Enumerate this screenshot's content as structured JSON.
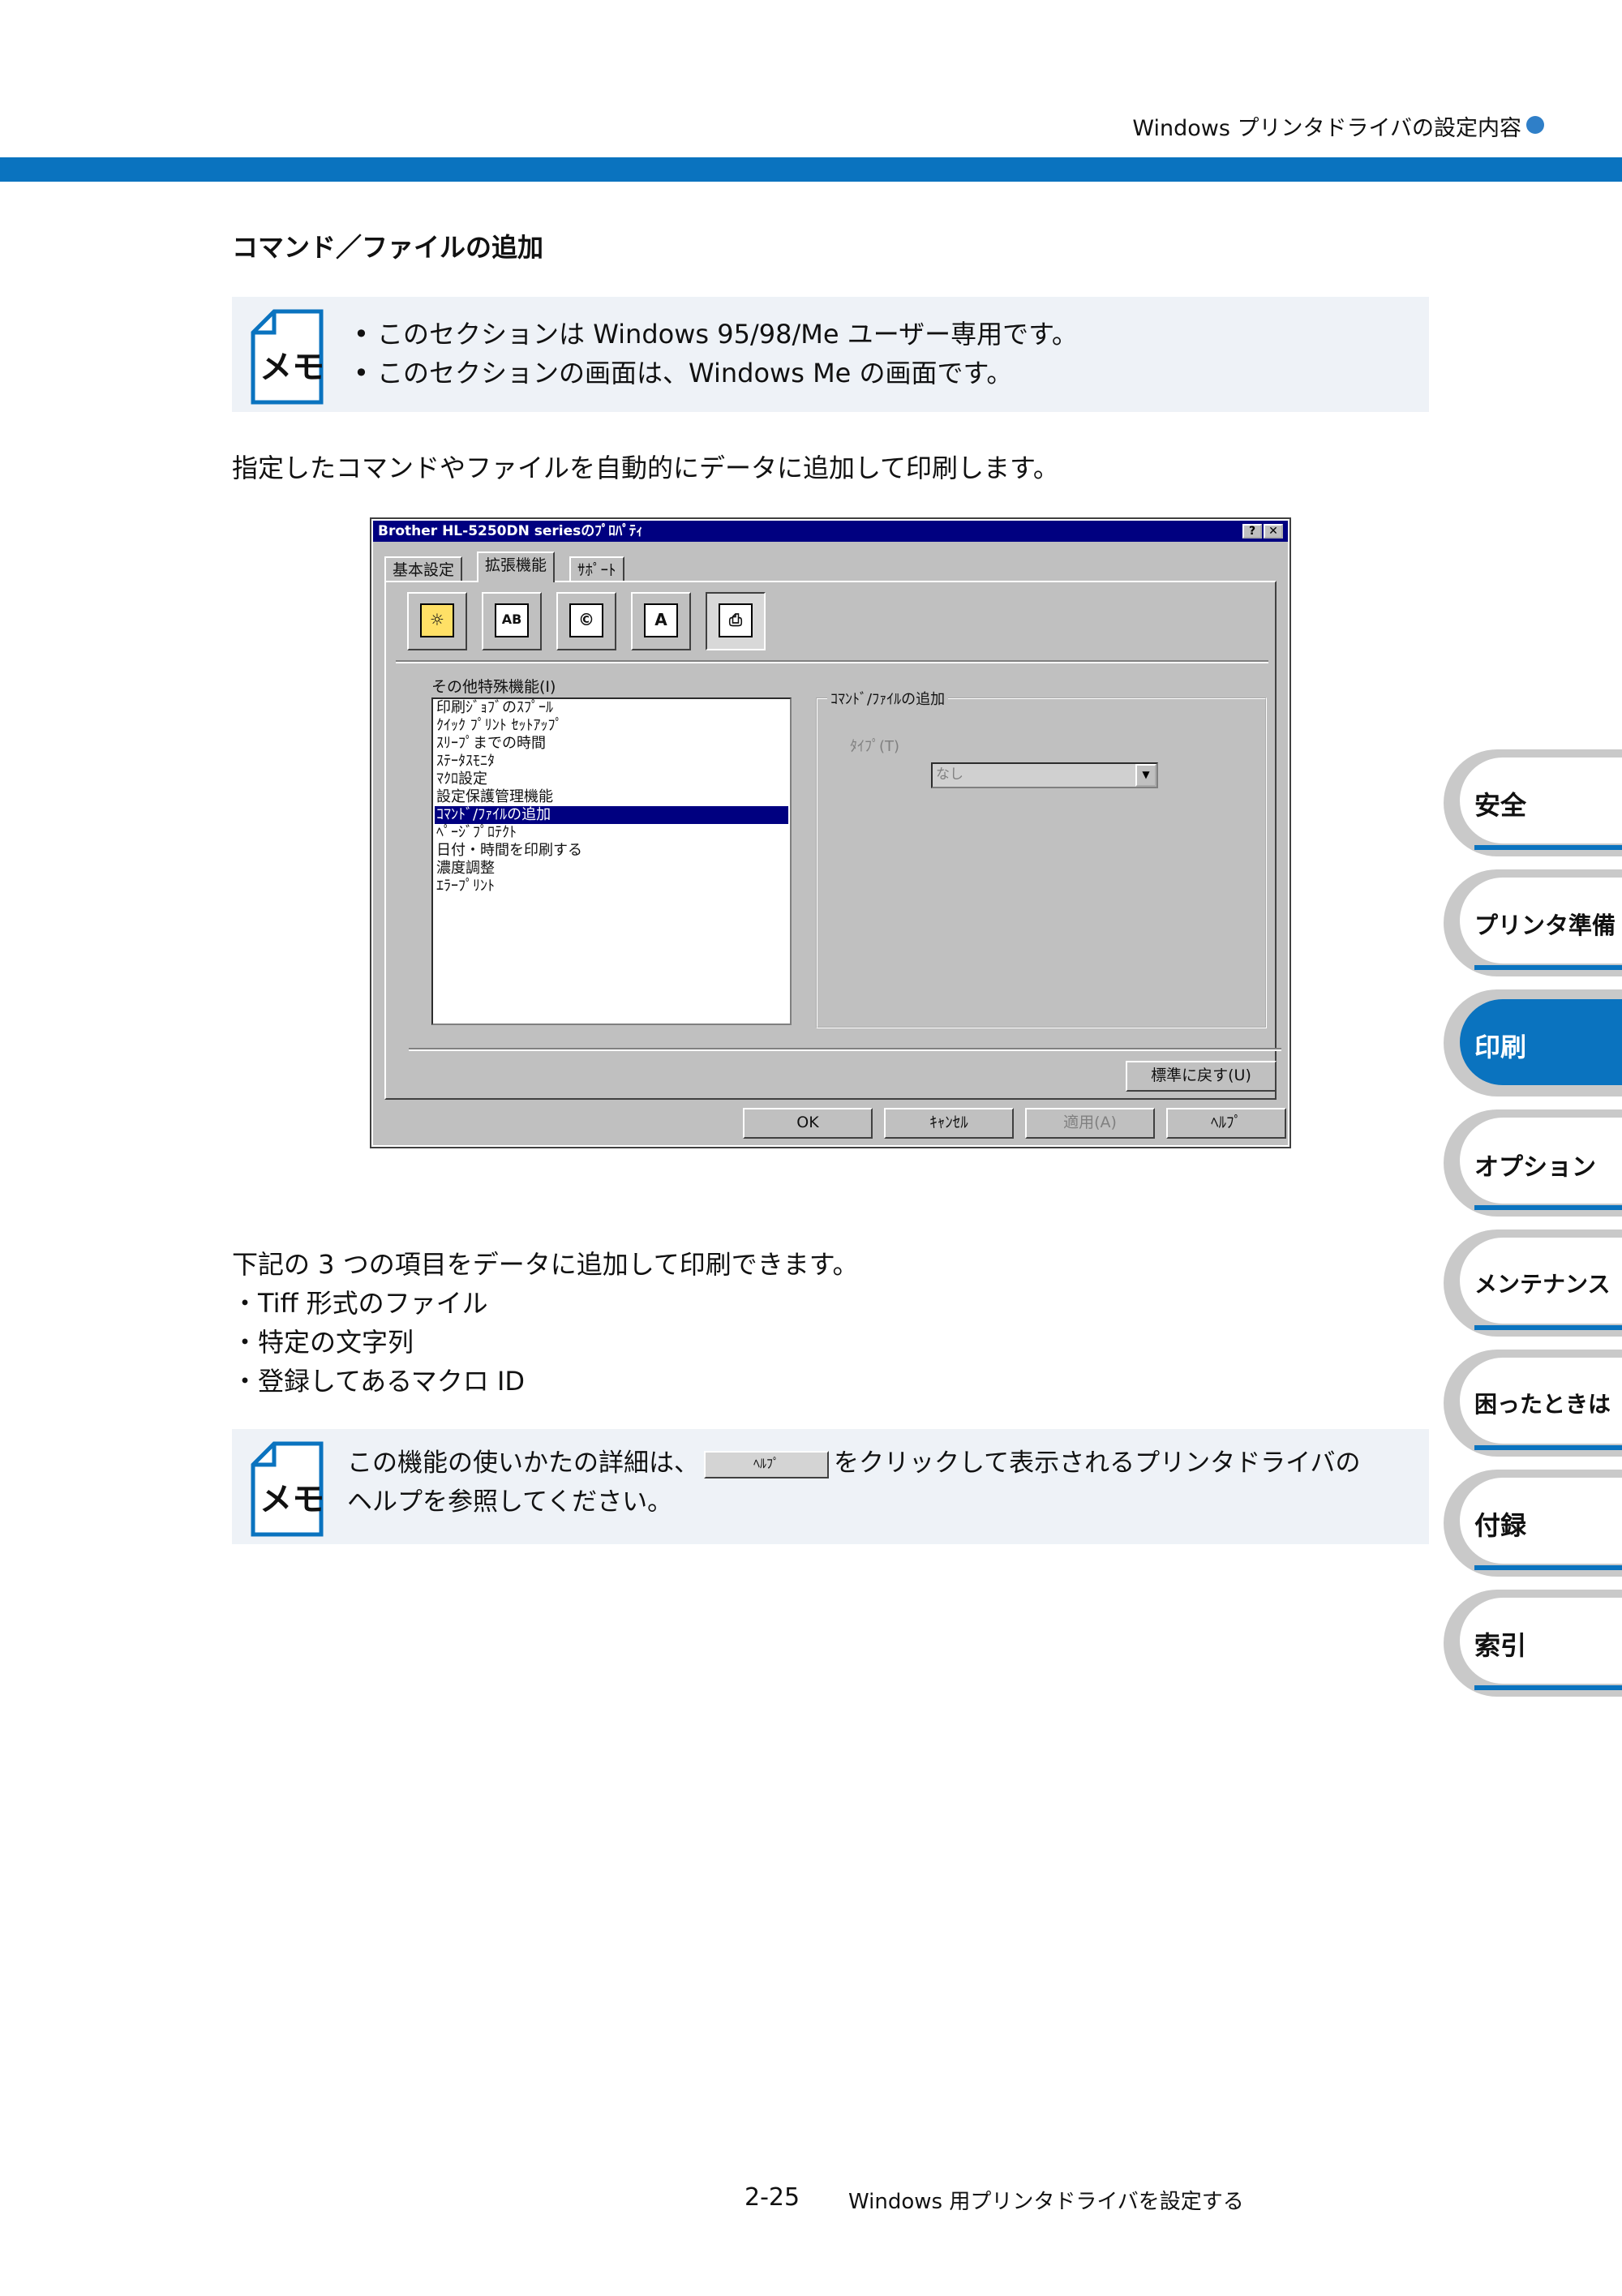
{
  "header": {
    "running_title": "Windows プリンタドライバの設定内容"
  },
  "section_title": "コマンド／ファイルの追加",
  "memo1": {
    "icon_label": "メモ",
    "lines": [
      "このセクションは Windows 95/98/Me ユーザー専用です。",
      "このセクションの画面は、Windows Me の画面です。"
    ]
  },
  "intro": "指定したコマンドやファイルを自動的にデータに追加して印刷します。",
  "dialog": {
    "title": "Brother HL-5250DN seriesのﾌﾟﾛﾊﾟﾃｨ",
    "help_btn": "?",
    "close_btn": "✕",
    "tabs": [
      "基本設定",
      "拡張機能",
      "ｻﾎﾟｰﾄ"
    ],
    "toolbar_icons": [
      "watermark-icon",
      "ab-icon",
      "copy-icon",
      "font-icon",
      "printer-settings-icon"
    ],
    "toolbar_glyphs": [
      "☼",
      "AB",
      "©",
      "A",
      "⎙"
    ],
    "list_label": "その他特殊機能(I)",
    "list_items": [
      "印刷ｼﾞｮﾌﾞのｽﾌﾟｰﾙ",
      "ｸｲｯｸ ﾌﾟﾘﾝﾄ ｾｯﾄｱｯﾌﾟ",
      "ｽﾘｰﾌﾟまでの時間",
      "ｽﾃｰﾀｽﾓﾆﾀ",
      "ﾏｸﾛ設定",
      "設定保護管理機能",
      "ｺﾏﾝﾄﾞ/ﾌｧｲﾙの追加",
      "ﾍﾟｰｼﾞﾌﾟﾛﾃｸﾄ",
      "日付・時間を印刷する",
      "濃度調整",
      "ｴﾗｰﾌﾟﾘﾝﾄ"
    ],
    "selected_index": 6,
    "group_label": "ｺﾏﾝﾄﾞ/ﾌｧｲﾙの追加",
    "type_label": "ﾀｲﾌﾟ(T)",
    "type_value": "なし",
    "reset_btn": "標準に戻す(U)",
    "ok_btn": "OK",
    "cancel_btn": "ｷｬﾝｾﾙ",
    "apply_btn": "適用(A)",
    "help_btn_bottom": "ﾍﾙﾌﾟ"
  },
  "list_intro": "下記の 3 つの項目をデータに追加して印刷できます。",
  "bullets": [
    "・Tiff 形式のファイル",
    "・特定の文字列",
    "・登録してあるマクロ ID"
  ],
  "memo2": {
    "icon_label": "メモ",
    "text_before": "この機能の使いかたの詳細は、",
    "button_label": "ﾍﾙﾌﾟ",
    "text_after": "をクリックして表示されるプリンタドライバの",
    "line2": "ヘルプを参照してください。"
  },
  "side_tabs": [
    {
      "label": "安全",
      "active": false
    },
    {
      "label": "プリンタ準備",
      "active": false
    },
    {
      "label": "印刷",
      "active": true
    },
    {
      "label": "オプション",
      "active": false
    },
    {
      "label": "メンテナンス",
      "active": false
    },
    {
      "label": "困ったときは",
      "active": false
    },
    {
      "label": "付録",
      "active": false
    },
    {
      "label": "索引",
      "active": false
    }
  ],
  "footer": {
    "page_number": "2-25",
    "chapter_title": "Windows 用プリンタドライバを設定する"
  },
  "colors": {
    "accent": "#0a73bf",
    "memo_bg": "#eef2f7",
    "dialog_gray": "#c0c0c0",
    "titlebar": "#000080"
  }
}
